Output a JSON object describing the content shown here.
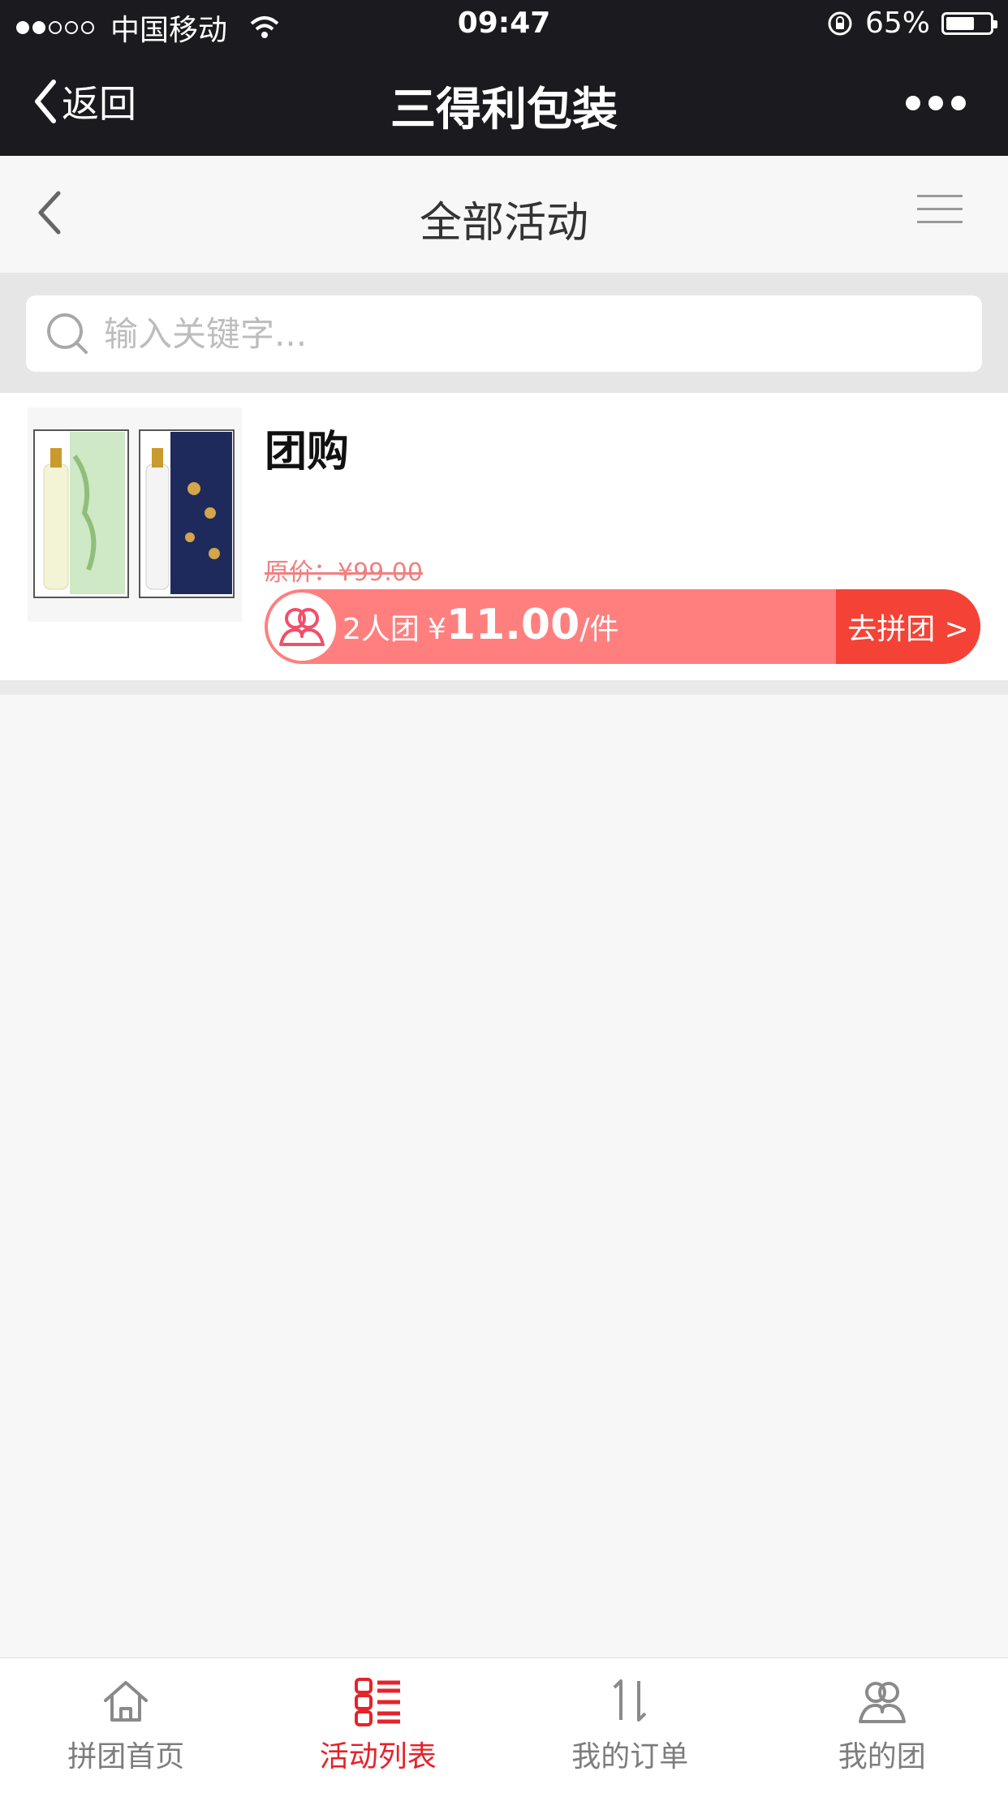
{
  "status_bar": {
    "carrier": "中国移动",
    "time": "09:47",
    "battery": "65%",
    "battery_level": 0.65
  },
  "nav_bar": {
    "back_label": "返回",
    "title": "三得利包装"
  },
  "sub_header": {
    "title": "全部活动"
  },
  "search": {
    "placeholder": "输入关键字..."
  },
  "products": [
    {
      "title": "团购",
      "original_price": "原价：¥99.00",
      "group_size": "2人团",
      "currency": "¥",
      "price": "11.00",
      "unit": "/件",
      "join_label": "去拼团 >"
    }
  ],
  "tab_bar": {
    "tabs": [
      {
        "label": "拼团首页",
        "icon": "home-icon"
      },
      {
        "label": "活动列表",
        "icon": "list-icon"
      },
      {
        "label": "我的订单",
        "icon": "sort-icon"
      },
      {
        "label": "我的团",
        "icon": "group-icon"
      }
    ],
    "active_index": 1,
    "active_color": "#e6222a"
  },
  "colors": {
    "header_bg": "#1b1b1f",
    "group_bar": "#ff7f7f",
    "join_button": "#f44336"
  }
}
